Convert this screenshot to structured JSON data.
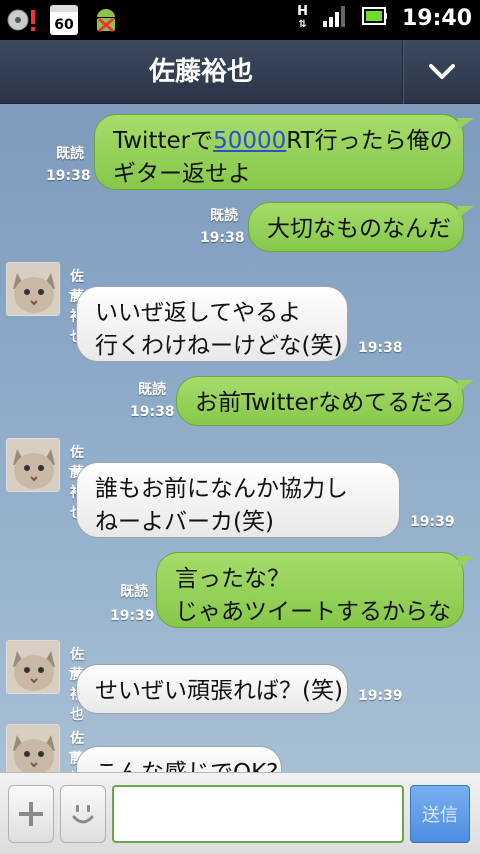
{
  "status_bar": {
    "time": "19:40",
    "calendar_day": "60",
    "network_label": "H"
  },
  "header": {
    "title": "佐藤裕也"
  },
  "messages": [
    {
      "type": "out",
      "line1_pre": "Twitterで",
      "line1_link": "50000",
      "line1_post": "RT行ったら俺の",
      "line2": "ギター返せよ",
      "read": "既読",
      "time": "19:38"
    },
    {
      "type": "out",
      "text": "大切なものなんだ",
      "read": "既読",
      "time": "19:38"
    },
    {
      "type": "in",
      "sender": "佐藤裕也",
      "line1": "いいぜ返してやるよ",
      "line2": "行くわけねーけどな(笑)",
      "time": "19:38"
    },
    {
      "type": "out",
      "text": "お前Twitterなめてるだろ",
      "read": "既読",
      "time": "19:38"
    },
    {
      "type": "in",
      "sender": "佐藤裕也",
      "line1": "誰もお前になんか協力し",
      "line2": "ねーよバーカ(笑)",
      "time": "19:39"
    },
    {
      "type": "out",
      "line1": "言ったな？",
      "line2": "じゃあツイートするからな",
      "read": "既読",
      "time": "19:39"
    },
    {
      "type": "in",
      "sender": "佐藤裕也",
      "text": "せいぜい頑張れば？(笑)",
      "time": "19:39"
    },
    {
      "type": "in",
      "sender": "佐藤裕也",
      "text": "こんな感じでOK?"
    }
  ],
  "input_bar": {
    "send_label": "送信",
    "placeholder": ""
  },
  "colors": {
    "header_bg": "#33405a",
    "out_bubble": "#97d25a",
    "in_bubble": "#ffffff",
    "chat_bg": "#8aa7c6",
    "send_button": "#5f9ae8"
  }
}
